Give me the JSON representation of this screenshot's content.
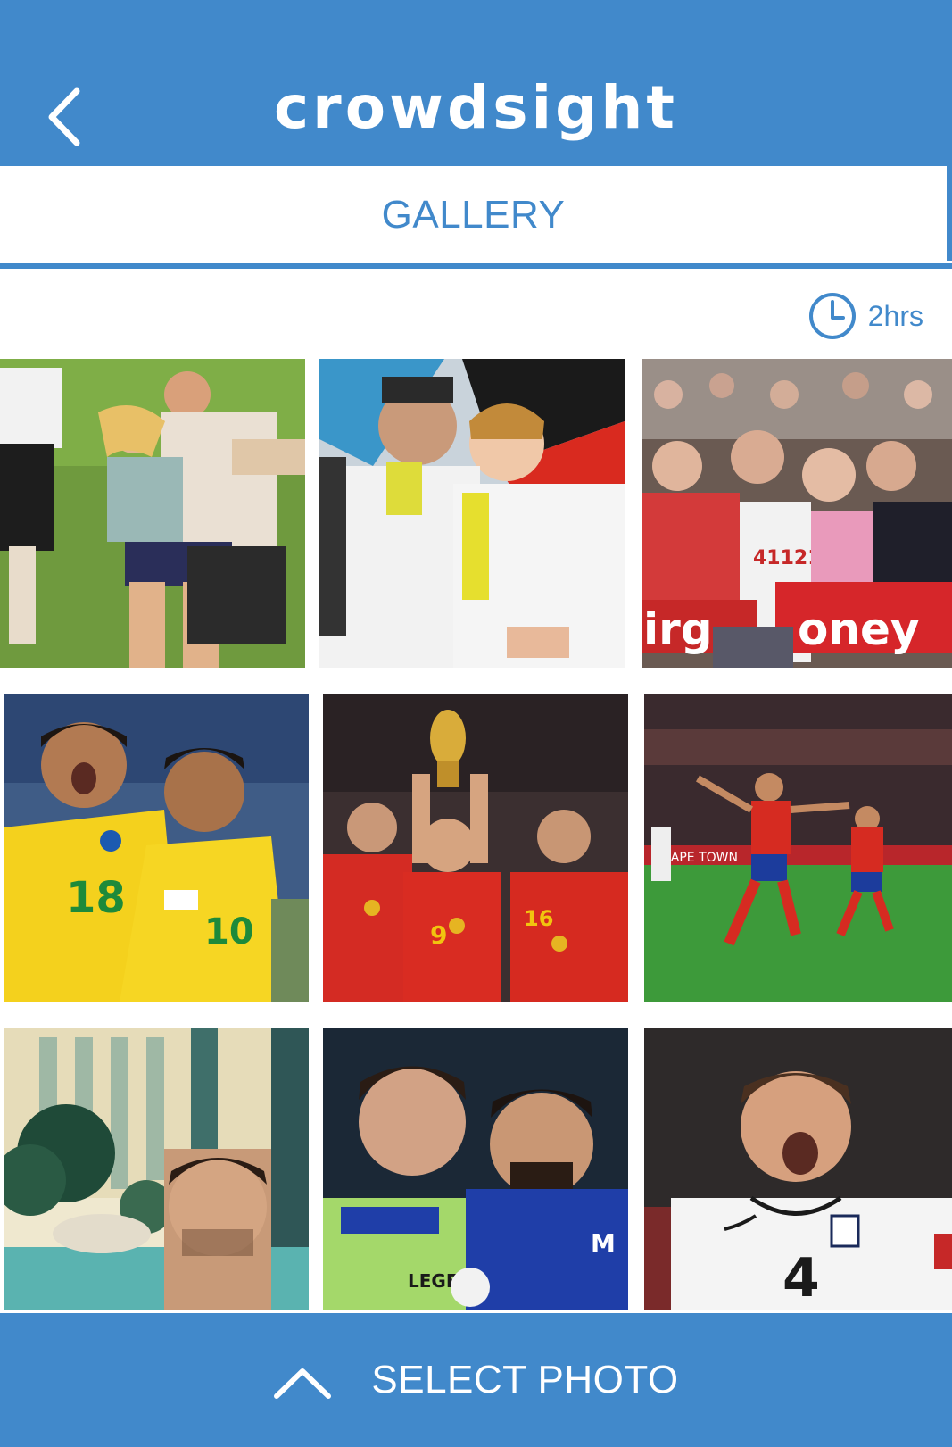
{
  "header": {
    "app_name": "crowdsight",
    "back_icon": "chevron-left-icon"
  },
  "tabs": [
    {
      "label": "GALLERY",
      "active": true
    }
  ],
  "timer": {
    "icon": "clock-icon",
    "label": "2hrs"
  },
  "gallery": {
    "photos": [
      {
        "subject": "pitch invader celebration on grass field"
      },
      {
        "subject": "two athletes in white team jackets in front of German flag"
      },
      {
        "subject": "cheering marathon crowd with red banner"
      },
      {
        "subject": "two players in yellow Brazil kits celebrating"
      },
      {
        "subject": "team in red kits lifting World Cup trophy"
      },
      {
        "subject": "player in red kit running with arms outstretched"
      },
      {
        "subject": "man portrait with hotel pool and lion statue"
      },
      {
        "subject": "two players embracing, green and blue kits"
      },
      {
        "subject": "player in white England kit shouting, number 4"
      }
    ]
  },
  "footer": {
    "icon": "chevron-up-icon",
    "label": "SELECT PHOTO"
  },
  "colors": {
    "brand_blue": "#4189cb",
    "background": "#ffffff"
  }
}
